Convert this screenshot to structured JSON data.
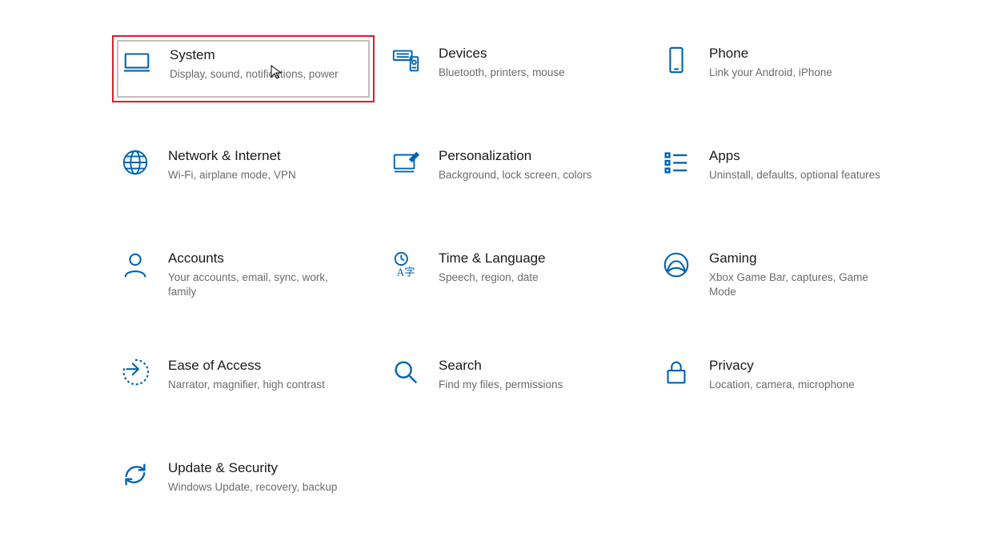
{
  "tiles": {
    "system": {
      "title": "System",
      "sub": "Display, sound, notifications, power"
    },
    "devices": {
      "title": "Devices",
      "sub": "Bluetooth, printers, mouse"
    },
    "phone": {
      "title": "Phone",
      "sub": "Link your Android, iPhone"
    },
    "network": {
      "title": "Network & Internet",
      "sub": "Wi-Fi, airplane mode, VPN"
    },
    "personalization": {
      "title": "Personalization",
      "sub": "Background, lock screen, colors"
    },
    "apps": {
      "title": "Apps",
      "sub": "Uninstall, defaults, optional features"
    },
    "accounts": {
      "title": "Accounts",
      "sub": "Your accounts, email, sync, work, family"
    },
    "time": {
      "title": "Time & Language",
      "sub": "Speech, region, date"
    },
    "gaming": {
      "title": "Gaming",
      "sub": "Xbox Game Bar, captures, Game Mode"
    },
    "ease": {
      "title": "Ease of Access",
      "sub": "Narrator, magnifier, high contrast"
    },
    "search": {
      "title": "Search",
      "sub": "Find my files, permissions"
    },
    "privacy": {
      "title": "Privacy",
      "sub": "Location, camera, microphone"
    },
    "update": {
      "title": "Update & Security",
      "sub": "Windows Update, recovery, backup"
    }
  }
}
